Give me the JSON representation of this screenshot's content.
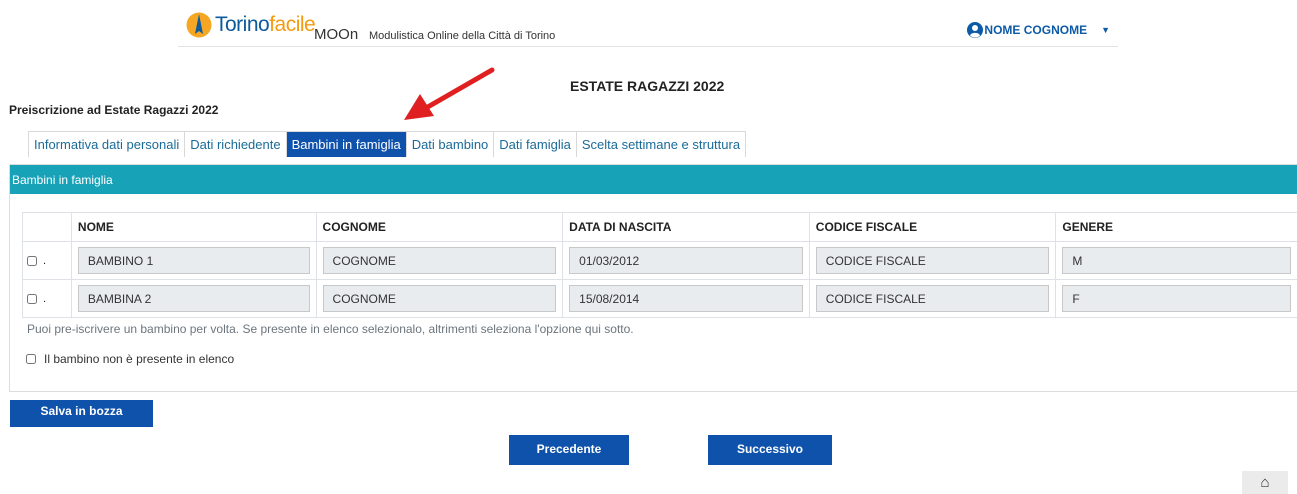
{
  "header": {
    "logo_part1": "Torino",
    "logo_part2": "facile",
    "app_name": "MOOn",
    "app_subtitle": "Modulistica Online della Città di Torino",
    "user_name": "NOME COGNOME",
    "user_caret": "▼"
  },
  "page_title": "ESTATE RAGAZZI 2022",
  "form_title": "Preiscrizione ad Estate Ragazzi 2022",
  "tabs": [
    {
      "label": "Informativa dati personali",
      "active": false
    },
    {
      "label": "Dati richiedente",
      "active": false
    },
    {
      "label": "Bambini in famiglia",
      "active": true
    },
    {
      "label": "Dati bambino",
      "active": false
    },
    {
      "label": "Dati famiglia",
      "active": false
    },
    {
      "label": "Scelta settimane e struttura",
      "active": false
    }
  ],
  "panel": {
    "title": "Bambini in famiglia",
    "columns": [
      "NOME",
      "COGNOME",
      "DATA DI NASCITA",
      "CODICE FISCALE",
      "GENERE"
    ],
    "rows": [
      {
        "marker": ".",
        "nome": "BAMBINO   1",
        "cognome": "COGNOME",
        "data_nascita": "01/03/2012",
        "codice_fiscale": "CODICE FISCALE",
        "genere": "M"
      },
      {
        "marker": ".",
        "nome": "BAMBINA   2",
        "cognome": "COGNOME",
        "data_nascita": "15/08/2014",
        "codice_fiscale": "CODICE FISCALE",
        "genere": "F"
      }
    ],
    "help_text": "Puoi pre-iscrivere un bambino per volta. Se presente in elenco selezionalo, altrimenti seleziona l'opzione qui sotto.",
    "not_present_label": "Il bambino non è presente in elenco"
  },
  "buttons": {
    "save_draft": "Salva in bozza",
    "previous": "Precedente",
    "next": "Successivo"
  },
  "home_icon": "⌂",
  "colors": {
    "primary": "#0f52ac",
    "panel_header": "#17a2b8",
    "annotation_arrow": "#e02020"
  }
}
